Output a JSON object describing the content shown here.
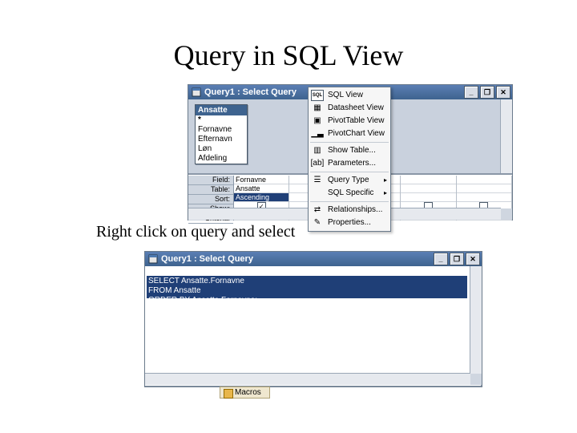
{
  "slide": {
    "title": "Query in SQL View",
    "caption": "Right click on query and select"
  },
  "design_window": {
    "title_text": "Query1 : Select Query",
    "table": {
      "name": "Ansatte",
      "fields": [
        "*",
        "Fornavne",
        "Efternavn",
        "Løn",
        "Afdeling"
      ]
    },
    "grid": {
      "row_labels": [
        "Field:",
        "Table:",
        "Sort:",
        "Show:",
        "Criteria:"
      ],
      "columns": [
        {
          "field": "Fornavne",
          "table": "Ansatte",
          "sort": "Ascending",
          "show": true
        },
        {
          "field": "",
          "table": "",
          "sort": "",
          "show": false
        },
        {
          "field": "",
          "table": "",
          "sort": "",
          "show": false
        },
        {
          "field": "",
          "table": "",
          "sort": "",
          "show": false
        },
        {
          "field": "",
          "table": "",
          "sort": "",
          "show": false
        }
      ]
    }
  },
  "context_menu": {
    "items": [
      {
        "label": "SQL View",
        "icon": "sql"
      },
      {
        "label": "Datasheet View",
        "icon": "grid"
      },
      {
        "label": "PivotTable View",
        "icon": "pivot"
      },
      {
        "label": "PivotChart View",
        "icon": "chart"
      },
      {
        "sep": true
      },
      {
        "label": "Show Table...",
        "icon": "showtable"
      },
      {
        "label": "Parameters...",
        "icon": "params"
      },
      {
        "sep": true
      },
      {
        "label": "Query Type",
        "icon": "qtype",
        "sub": true
      },
      {
        "label": "SQL Specific",
        "icon": "",
        "sub": true
      },
      {
        "sep": true
      },
      {
        "label": "Relationships...",
        "icon": "relat"
      },
      {
        "label": "Properties...",
        "icon": "props"
      }
    ]
  },
  "sql_window": {
    "title_text": "Query1 : Select Query",
    "sql_lines": [
      "SELECT Ansatte.Fornavne",
      "FROM Ansatte",
      "ORDER BY Ansatte.Fornavne;"
    ]
  },
  "tab_fragment": {
    "label": "Macros"
  },
  "icons": {
    "sql": "SQL",
    "grid": "▦",
    "pivot": "▣",
    "chart": "▁▃",
    "showtable": "▥",
    "params": "[ab]",
    "qtype": "☰",
    "relat": "⇄",
    "props": "✎"
  }
}
